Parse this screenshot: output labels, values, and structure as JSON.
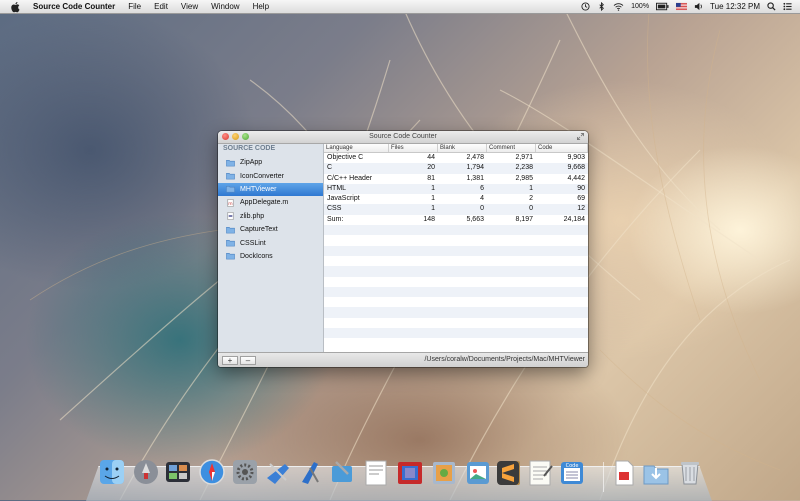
{
  "menubar": {
    "app_name": "Source Code Counter",
    "menus": [
      "File",
      "Edit",
      "View",
      "Window",
      "Help"
    ],
    "battery": "100%",
    "clock": "Tue 12:32 PM"
  },
  "window": {
    "title": "Source Code Counter",
    "sidebar_header": "SOURCE CODE",
    "sidebar_items": [
      {
        "label": "ZipApp",
        "icon": "folder-icon",
        "selected": false
      },
      {
        "label": "IconConverter",
        "icon": "folder-icon",
        "selected": false
      },
      {
        "label": "MHTViewer",
        "icon": "folder-icon",
        "selected": true
      },
      {
        "label": "AppDelegate.m",
        "icon": "objc-file-icon",
        "selected": false
      },
      {
        "label": "zlib.php",
        "icon": "php-file-icon",
        "selected": false
      },
      {
        "label": "CaptureText",
        "icon": "folder-icon",
        "selected": false
      },
      {
        "label": "CSSLint",
        "icon": "folder-icon",
        "selected": false
      },
      {
        "label": "DockIcons",
        "icon": "folder-icon",
        "selected": false
      }
    ],
    "columns": [
      "Language",
      "Files",
      "Blank",
      "Comment",
      "Code"
    ],
    "rows": [
      [
        "Objective C",
        "44",
        "2,478",
        "2,971",
        "9,903"
      ],
      [
        "C",
        "20",
        "1,794",
        "2,238",
        "9,668"
      ],
      [
        "C/C++ Header",
        "81",
        "1,381",
        "2,985",
        "4,442"
      ],
      [
        "HTML",
        "1",
        "6",
        "1",
        "90"
      ],
      [
        "JavaScript",
        "1",
        "4",
        "2",
        "69"
      ],
      [
        "CSS",
        "1",
        "0",
        "0",
        "12"
      ],
      [
        "Sum:",
        "148",
        "5,663",
        "8,197",
        "24,184"
      ]
    ],
    "empty_rows": 12,
    "add_label": "+",
    "remove_label": "–",
    "path": "/Users/coralw/Documents/Projects/Mac/MHTViewer"
  },
  "dock": {
    "icons": [
      "finder-icon",
      "launchpad-icon",
      "mission-control-icon",
      "safari-icon",
      "system-preferences-icon",
      "xcode-icon",
      "instruments-icon",
      "developer-tool-icon",
      "preview-icon",
      "photo-booth-icon",
      "books-icon",
      "iphoto-icon",
      "address-book-icon",
      "sublime-text-icon",
      "textedit-icon",
      "source-code-counter-icon",
      "document-icon",
      "downloads-folder-icon",
      "trash-icon"
    ]
  },
  "colors": {
    "selection": "#2f78d1",
    "sidebar_bg": "#dde3ea",
    "header_text": "#6f7f90"
  }
}
